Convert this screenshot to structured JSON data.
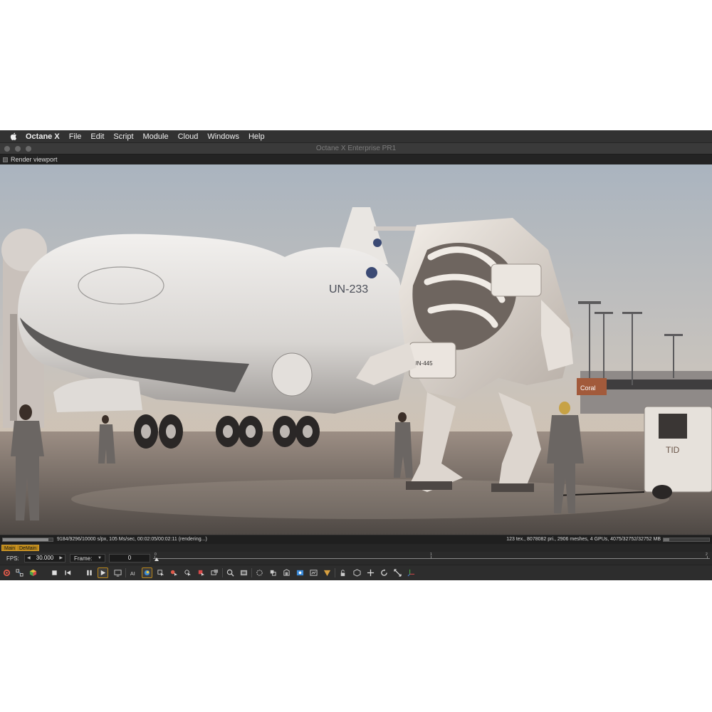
{
  "menubar": {
    "app_name": "Octane X",
    "items": [
      "File",
      "Edit",
      "Script",
      "Module",
      "Cloud",
      "Windows",
      "Help"
    ]
  },
  "window": {
    "title": "Octane X Enterprise PR1"
  },
  "panel": {
    "title": "Render viewport"
  },
  "render_scene": {
    "aircraft_tail_number": "UN-233",
    "robot_id": "UN-445",
    "tug_label": "TID",
    "sign_label": "Coral"
  },
  "status": {
    "progress_fraction": 0.92,
    "left_text": "9184/9296/10000 s/px, 105 Ms/sec, 00:02:05/00:02:11 (rendering...)",
    "right_text": "123 tex., 8078082 pri., 2906 meshes, 4 GPUs, 4075/32752/32752 MB",
    "memory_fraction": 0.12
  },
  "tabs": {
    "main": "Main",
    "demain": "DeMain"
  },
  "animation": {
    "fps_label": "FPS:",
    "fps_value": "30.000",
    "frame_label": "Frame:",
    "frame_value": "0",
    "timeline_labels": [
      "0",
      "1",
      "2"
    ]
  },
  "toolbar": {
    "tools": [
      "settings-icon",
      "export-icon",
      "color-cube-icon",
      "stop-icon",
      "rewind-icon",
      "pause-icon",
      "play-icon",
      "display-icon",
      "ai-light-icon",
      "render-layer-icon",
      "object-picker-icon",
      "material-picker-icon",
      "camera-target-icon",
      "focus-picker-icon",
      "white-balance-icon",
      "region-render-icon",
      "film-region-icon",
      "lock-viewport-icon",
      "clay-mode-icon",
      "subsample-icon",
      "priority-icon",
      "export-image-icon",
      "reset-icon",
      "viewport-lock-icon",
      "camera-view-icon",
      "move-icon",
      "rotate-icon",
      "scale-icon",
      "gizmo-icon"
    ]
  },
  "colors": {
    "accent": "#b8861a",
    "chrome": "#2b2b2b"
  }
}
